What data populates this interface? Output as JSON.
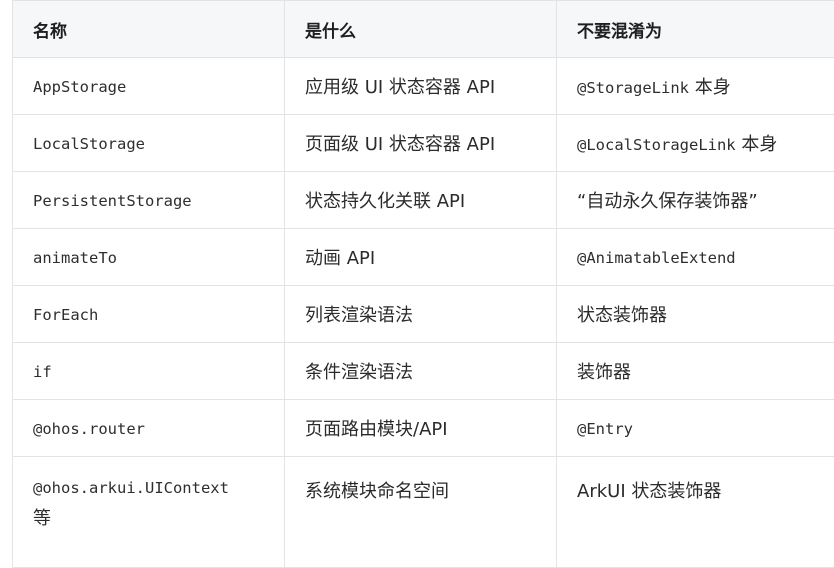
{
  "table": {
    "headers": [
      "名称",
      "是什么",
      "不要混淆为"
    ],
    "rows": [
      {
        "name": "AppStorage",
        "what": "应用级 UI 状态容器 API",
        "not_code": "@StorageLink",
        "not_text": " 本身"
      },
      {
        "name": "LocalStorage",
        "what": "页面级 UI 状态容器 API",
        "not_code": "@LocalStorageLink",
        "not_text": " 本身"
      },
      {
        "name": "PersistentStorage",
        "what": "状态持久化关联 API",
        "not_code": "",
        "not_text": "“自动永久保存装饰器”"
      },
      {
        "name": "animateTo",
        "what": "动画 API",
        "not_code": "@AnimatableExtend",
        "not_text": ""
      },
      {
        "name": "ForEach",
        "what": "列表渲染语法",
        "not_code": "",
        "not_text": "状态装饰器"
      },
      {
        "name": "if",
        "what": "条件渲染语法",
        "not_code": "",
        "not_text": "装饰器"
      },
      {
        "name": "@ohos.router",
        "what": "页面路由模块/API",
        "not_code": "@Entry",
        "not_text": ""
      },
      {
        "name": "@ohos.arkui.UIContext",
        "name_suffix": "等",
        "what": "系统模块命名空间",
        "not_code": "",
        "not_text": "ArkUI 状态装饰器"
      }
    ]
  }
}
